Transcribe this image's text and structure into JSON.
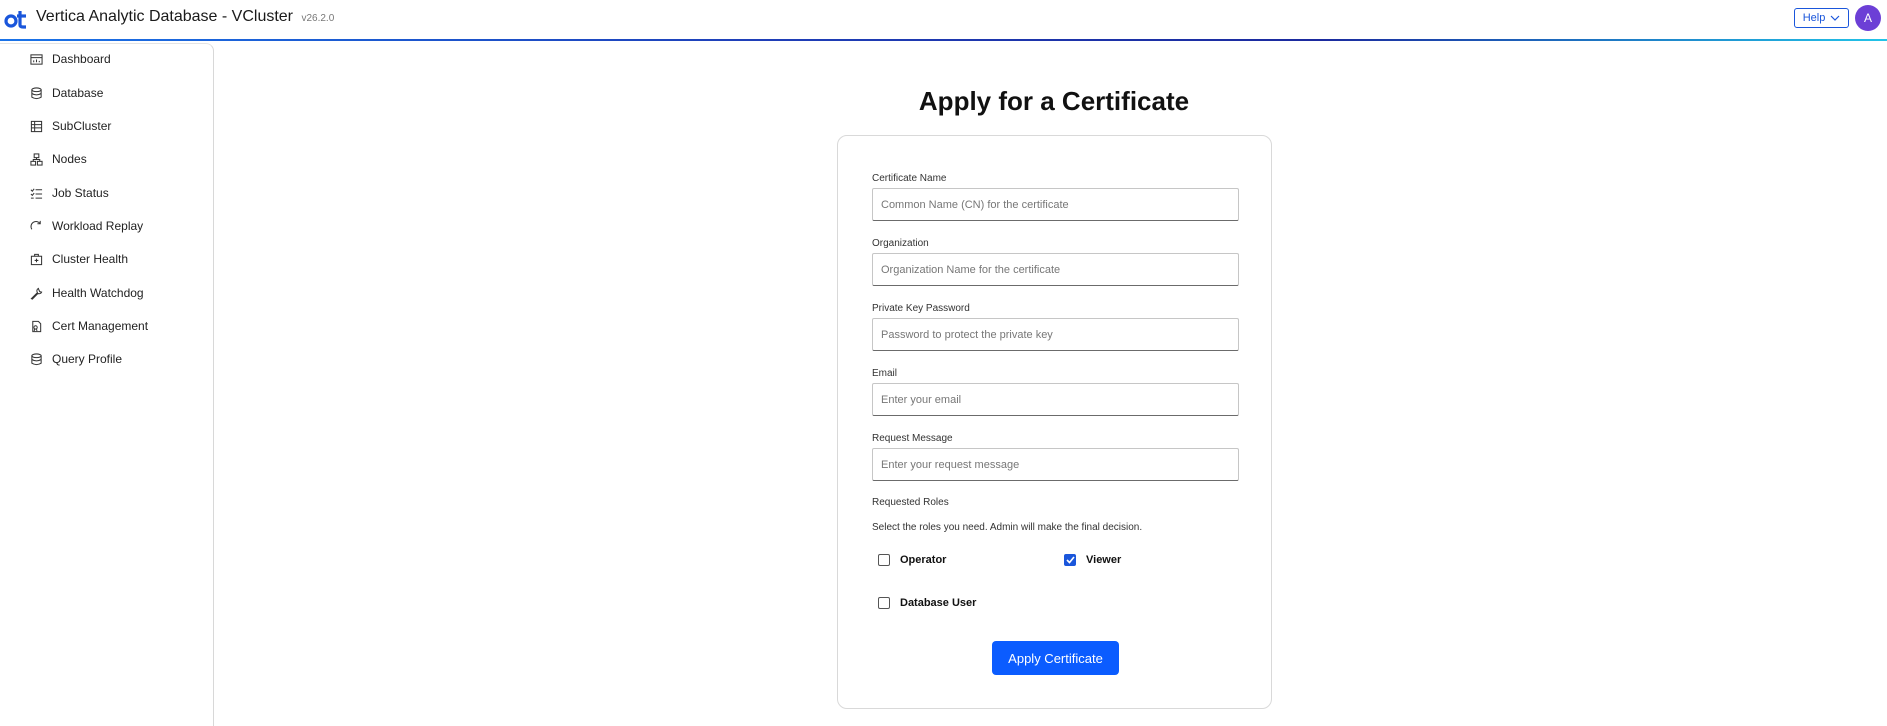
{
  "header": {
    "title": "Vertica Analytic Database - VCluster",
    "version": "v26.2.0",
    "help_label": "Help",
    "avatar_initial": "A",
    "accent_color": "#1a56db"
  },
  "sidebar": {
    "items": [
      {
        "label": "Dashboard",
        "icon": "dashboard-icon"
      },
      {
        "label": "Database",
        "icon": "database-icon"
      },
      {
        "label": "SubCluster",
        "icon": "subcluster-icon"
      },
      {
        "label": "Nodes",
        "icon": "nodes-icon"
      },
      {
        "label": "Job Status",
        "icon": "job-status-icon"
      },
      {
        "label": "Workload Replay",
        "icon": "replay-icon"
      },
      {
        "label": "Cluster Health",
        "icon": "cluster-health-icon"
      },
      {
        "label": "Health Watchdog",
        "icon": "wrench-icon"
      },
      {
        "label": "Cert Management",
        "icon": "certificate-icon"
      },
      {
        "label": "Query Profile",
        "icon": "query-profile-icon"
      }
    ]
  },
  "form": {
    "title": "Apply for a Certificate",
    "fields": [
      {
        "label": "Certificate Name",
        "placeholder": "Common Name (CN) for the certificate",
        "value": ""
      },
      {
        "label": "Organization",
        "placeholder": "Organization Name for the certificate",
        "value": ""
      },
      {
        "label": "Private Key Password",
        "placeholder": "Password to protect the private key",
        "value": ""
      },
      {
        "label": "Email",
        "placeholder": "Enter your email",
        "value": ""
      },
      {
        "label": "Request Message",
        "placeholder": "Enter your request message",
        "value": ""
      }
    ],
    "roles_title": "Requested Roles",
    "roles_help": "Select the roles you need. Admin will make the final decision.",
    "roles": [
      {
        "label": "Operator",
        "checked": false
      },
      {
        "label": "Viewer",
        "checked": true
      },
      {
        "label": "Database User",
        "checked": false
      }
    ],
    "submit_label": "Apply Certificate"
  }
}
